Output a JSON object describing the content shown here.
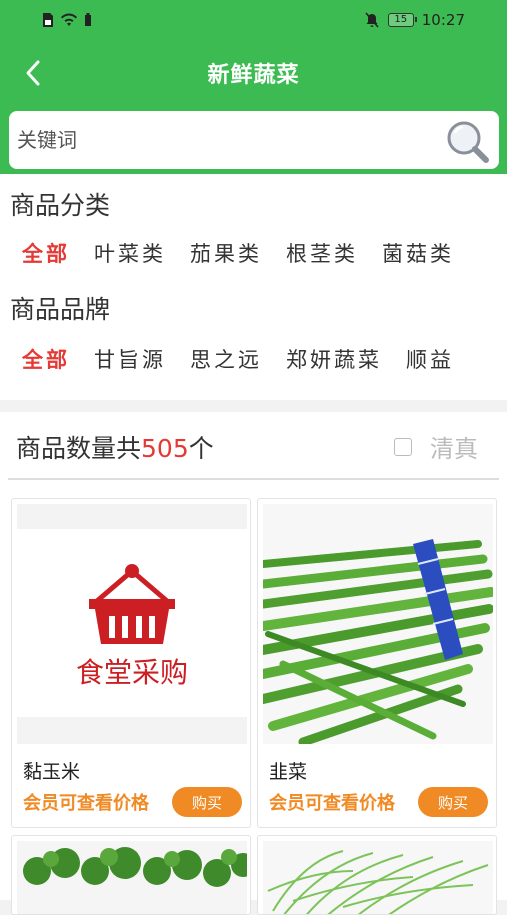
{
  "status_bar": {
    "time": "10:27",
    "battery_level": "15"
  },
  "header": {
    "title": "新鲜蔬菜"
  },
  "search": {
    "placeholder": "关键词"
  },
  "categories": {
    "title": "商品分类",
    "items": [
      "全部",
      "叶菜类",
      "茄果类",
      "根茎类",
      "菌菇类"
    ],
    "active_index": 0
  },
  "brands": {
    "title": "商品品牌",
    "items": [
      "全部",
      "甘旨源",
      "思之远",
      "郑妍蔬菜",
      "顺益"
    ],
    "active_index": 0
  },
  "count_bar": {
    "prefix": "商品数量共",
    "count": "505",
    "suffix": "个",
    "clear_label": "清真"
  },
  "products": [
    {
      "name": "黏玉米",
      "price_text": "会员可查看价格",
      "buy_label": "购买",
      "image_text": "食堂采购"
    },
    {
      "name": "韭菜",
      "price_text": "会员可查看价格",
      "buy_label": "购买"
    }
  ],
  "colors": {
    "brand_green": "#3cbb52",
    "active_red": "#e53935",
    "accent_orange": "#f08a24"
  }
}
